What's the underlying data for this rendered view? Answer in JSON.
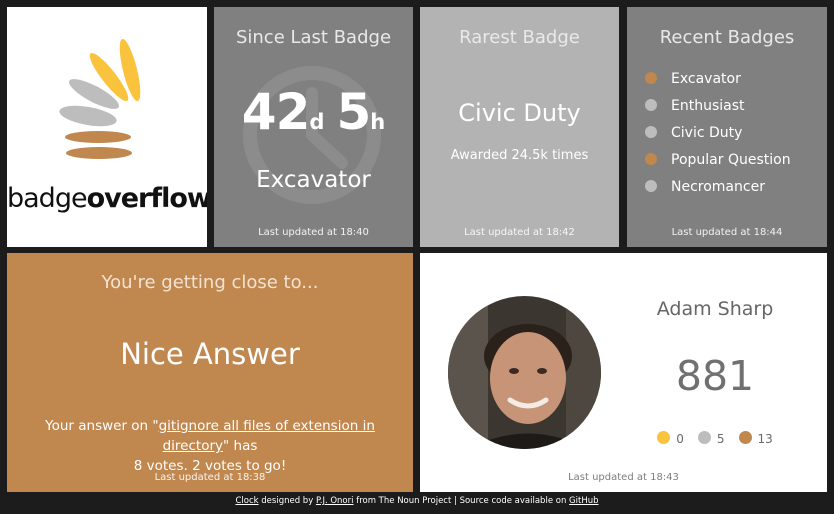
{
  "colors": {
    "gold": "#f9c33d",
    "silver": "#bdbdbd",
    "bronze": "#c0874f"
  },
  "logo": {
    "prefix": "badge",
    "suffix": "overflow"
  },
  "since_last_badge": {
    "title": "Since Last Badge",
    "days": "42",
    "days_unit": "d",
    "hours": "5",
    "hours_unit": "h",
    "badge": "Excavator",
    "updated": "Last updated at 18:40",
    "icon": "clock-icon"
  },
  "rarest_badge": {
    "title": "Rarest Badge",
    "badge": "Civic Duty",
    "awarded": "Awarded 24.5k times",
    "updated": "Last updated at 18:42"
  },
  "recent_badges": {
    "title": "Recent Badges",
    "items": [
      {
        "label": "Excavator",
        "tier": "bronze"
      },
      {
        "label": "Enthusiast",
        "tier": "silver"
      },
      {
        "label": "Civic Duty",
        "tier": "silver"
      },
      {
        "label": "Popular Question",
        "tier": "bronze"
      },
      {
        "label": "Necromancer",
        "tier": "silver"
      }
    ],
    "updated": "Last updated at 18:44"
  },
  "getting_close": {
    "heading": "You're getting close to...",
    "badge": "Nice Answer",
    "desc_prefix": "Your answer on \"",
    "question": "gitignore all files of extension in directory",
    "desc_middle": "\" has",
    "desc_votes": "8 votes. 2 votes to go!",
    "updated": "Last updated at 18:38"
  },
  "profile": {
    "name": "Adam Sharp",
    "reputation": "881",
    "gold": "0",
    "silver": "5",
    "bronze": "13",
    "updated": "Last updated at 18:43"
  },
  "footer": {
    "clock_link": "Clock",
    "designed_by": " designed by ",
    "author": "P.J. Onori",
    "from": " from The Noun Project | Source code available on ",
    "github": "GitHub"
  }
}
